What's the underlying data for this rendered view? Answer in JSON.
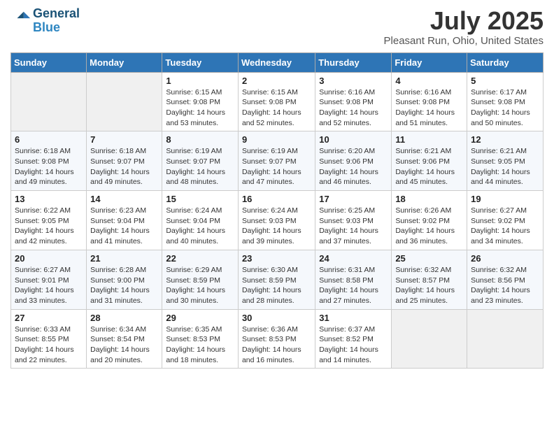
{
  "logo": {
    "line1": "General",
    "line2": "Blue"
  },
  "title": {
    "month_year": "July 2025",
    "location": "Pleasant Run, Ohio, United States"
  },
  "days_of_week": [
    "Sunday",
    "Monday",
    "Tuesday",
    "Wednesday",
    "Thursday",
    "Friday",
    "Saturday"
  ],
  "weeks": [
    [
      {
        "num": "",
        "info": ""
      },
      {
        "num": "",
        "info": ""
      },
      {
        "num": "1",
        "info": "Sunrise: 6:15 AM\nSunset: 9:08 PM\nDaylight: 14 hours and 53 minutes."
      },
      {
        "num": "2",
        "info": "Sunrise: 6:15 AM\nSunset: 9:08 PM\nDaylight: 14 hours and 52 minutes."
      },
      {
        "num": "3",
        "info": "Sunrise: 6:16 AM\nSunset: 9:08 PM\nDaylight: 14 hours and 52 minutes."
      },
      {
        "num": "4",
        "info": "Sunrise: 6:16 AM\nSunset: 9:08 PM\nDaylight: 14 hours and 51 minutes."
      },
      {
        "num": "5",
        "info": "Sunrise: 6:17 AM\nSunset: 9:08 PM\nDaylight: 14 hours and 50 minutes."
      }
    ],
    [
      {
        "num": "6",
        "info": "Sunrise: 6:18 AM\nSunset: 9:08 PM\nDaylight: 14 hours and 49 minutes."
      },
      {
        "num": "7",
        "info": "Sunrise: 6:18 AM\nSunset: 9:07 PM\nDaylight: 14 hours and 49 minutes."
      },
      {
        "num": "8",
        "info": "Sunrise: 6:19 AM\nSunset: 9:07 PM\nDaylight: 14 hours and 48 minutes."
      },
      {
        "num": "9",
        "info": "Sunrise: 6:19 AM\nSunset: 9:07 PM\nDaylight: 14 hours and 47 minutes."
      },
      {
        "num": "10",
        "info": "Sunrise: 6:20 AM\nSunset: 9:06 PM\nDaylight: 14 hours and 46 minutes."
      },
      {
        "num": "11",
        "info": "Sunrise: 6:21 AM\nSunset: 9:06 PM\nDaylight: 14 hours and 45 minutes."
      },
      {
        "num": "12",
        "info": "Sunrise: 6:21 AM\nSunset: 9:05 PM\nDaylight: 14 hours and 44 minutes."
      }
    ],
    [
      {
        "num": "13",
        "info": "Sunrise: 6:22 AM\nSunset: 9:05 PM\nDaylight: 14 hours and 42 minutes."
      },
      {
        "num": "14",
        "info": "Sunrise: 6:23 AM\nSunset: 9:04 PM\nDaylight: 14 hours and 41 minutes."
      },
      {
        "num": "15",
        "info": "Sunrise: 6:24 AM\nSunset: 9:04 PM\nDaylight: 14 hours and 40 minutes."
      },
      {
        "num": "16",
        "info": "Sunrise: 6:24 AM\nSunset: 9:03 PM\nDaylight: 14 hours and 39 minutes."
      },
      {
        "num": "17",
        "info": "Sunrise: 6:25 AM\nSunset: 9:03 PM\nDaylight: 14 hours and 37 minutes."
      },
      {
        "num": "18",
        "info": "Sunrise: 6:26 AM\nSunset: 9:02 PM\nDaylight: 14 hours and 36 minutes."
      },
      {
        "num": "19",
        "info": "Sunrise: 6:27 AM\nSunset: 9:02 PM\nDaylight: 14 hours and 34 minutes."
      }
    ],
    [
      {
        "num": "20",
        "info": "Sunrise: 6:27 AM\nSunset: 9:01 PM\nDaylight: 14 hours and 33 minutes."
      },
      {
        "num": "21",
        "info": "Sunrise: 6:28 AM\nSunset: 9:00 PM\nDaylight: 14 hours and 31 minutes."
      },
      {
        "num": "22",
        "info": "Sunrise: 6:29 AM\nSunset: 8:59 PM\nDaylight: 14 hours and 30 minutes."
      },
      {
        "num": "23",
        "info": "Sunrise: 6:30 AM\nSunset: 8:59 PM\nDaylight: 14 hours and 28 minutes."
      },
      {
        "num": "24",
        "info": "Sunrise: 6:31 AM\nSunset: 8:58 PM\nDaylight: 14 hours and 27 minutes."
      },
      {
        "num": "25",
        "info": "Sunrise: 6:32 AM\nSunset: 8:57 PM\nDaylight: 14 hours and 25 minutes."
      },
      {
        "num": "26",
        "info": "Sunrise: 6:32 AM\nSunset: 8:56 PM\nDaylight: 14 hours and 23 minutes."
      }
    ],
    [
      {
        "num": "27",
        "info": "Sunrise: 6:33 AM\nSunset: 8:55 PM\nDaylight: 14 hours and 22 minutes."
      },
      {
        "num": "28",
        "info": "Sunrise: 6:34 AM\nSunset: 8:54 PM\nDaylight: 14 hours and 20 minutes."
      },
      {
        "num": "29",
        "info": "Sunrise: 6:35 AM\nSunset: 8:53 PM\nDaylight: 14 hours and 18 minutes."
      },
      {
        "num": "30",
        "info": "Sunrise: 6:36 AM\nSunset: 8:53 PM\nDaylight: 14 hours and 16 minutes."
      },
      {
        "num": "31",
        "info": "Sunrise: 6:37 AM\nSunset: 8:52 PM\nDaylight: 14 hours and 14 minutes."
      },
      {
        "num": "",
        "info": ""
      },
      {
        "num": "",
        "info": ""
      }
    ]
  ]
}
